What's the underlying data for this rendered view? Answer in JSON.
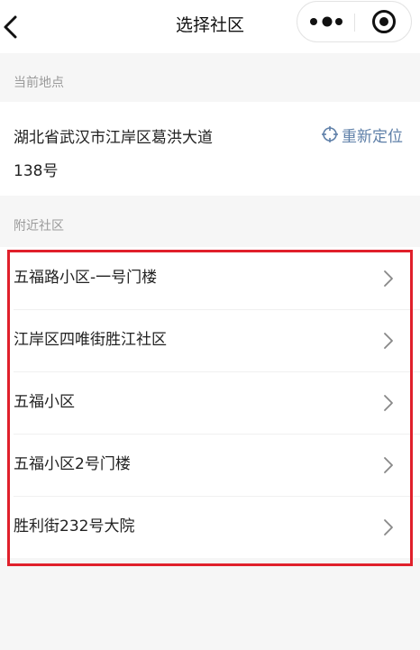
{
  "navbar": {
    "title": "选择社区",
    "back_icon": "chevron-left-icon",
    "menu_icon": "more-dots-icon",
    "close_icon": "target-close-icon"
  },
  "current_location": {
    "section_label": "当前地点",
    "address_line1": "湖北省武汉市江岸区葛洪大道",
    "address_line2": "138号",
    "relocate_label": "重新定位",
    "relocate_icon": "locate-crosshair-icon",
    "accent_color": "#5e7fa8"
  },
  "nearby": {
    "section_label": "附近社区",
    "items": [
      {
        "label": "五福路小区-一号门楼"
      },
      {
        "label": "江岸区四唯街胜江社区"
      },
      {
        "label": "五福小区"
      },
      {
        "label": "五福小区2号门楼"
      },
      {
        "label": "胜利街232号大院"
      }
    ],
    "item_icon": "chevron-right-icon"
  },
  "highlight_color": "#e0202b"
}
